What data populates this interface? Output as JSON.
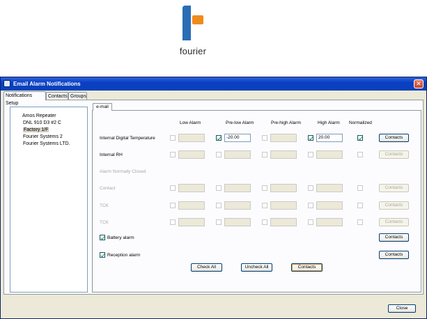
{
  "logo": {
    "text": "fourier"
  },
  "window": {
    "title": "Email Alarm Notifications",
    "close_glyph": "✕"
  },
  "tabs": [
    "Notifications Setup",
    "Contacts",
    "Groups"
  ],
  "tree": {
    "items": [
      {
        "label": "Amos Repeater",
        "root": true,
        "selected": false
      },
      {
        "label": "DNL 910 D3 #2 C",
        "root": false,
        "selected": false
      },
      {
        "label": "Factory 1/F",
        "root": false,
        "selected": true
      },
      {
        "label": "Fourier Systems 2",
        "root": false,
        "selected": false
      },
      {
        "label": "Fourier Systems LTD.",
        "root": false,
        "selected": false
      }
    ]
  },
  "inner_tab": "e-mail",
  "columns": {
    "low": "Low Alarm",
    "prelow": "Pre-low Alarm",
    "prehigh": "Pre-high Alarm",
    "high": "High Alarm",
    "normalized": "Normalized"
  },
  "rows": [
    {
      "label": "Internal Digital Temperature",
      "enabled": true,
      "low": {
        "checked": false,
        "value": ""
      },
      "prelow": {
        "checked": true,
        "value": "-20.00"
      },
      "prehigh": {
        "checked": false,
        "value": ""
      },
      "high": {
        "checked": true,
        "value": "20.00"
      },
      "normalized": true,
      "contacts_enabled": true
    },
    {
      "label": "Internal RH",
      "enabled": true,
      "low": {
        "checked": false,
        "value": ""
      },
      "prelow": {
        "checked": false,
        "value": ""
      },
      "prehigh": {
        "checked": false,
        "value": ""
      },
      "high": {
        "checked": false,
        "value": ""
      },
      "normalized": false,
      "contacts_enabled": false
    },
    {
      "label": "Alarm Normally Closed",
      "enabled": false,
      "header_only": true
    },
    {
      "label": "Contact",
      "enabled": false,
      "low": {
        "checked": false,
        "value": ""
      },
      "prelow": {
        "checked": false,
        "value": ""
      },
      "prehigh": {
        "checked": false,
        "value": ""
      },
      "high": {
        "checked": false,
        "value": ""
      },
      "normalized": false,
      "contacts_enabled": false
    },
    {
      "label": "TCK",
      "enabled": false,
      "low": {
        "checked": false,
        "value": ""
      },
      "prelow": {
        "checked": false,
        "value": ""
      },
      "prehigh": {
        "checked": false,
        "value": ""
      },
      "high": {
        "checked": false,
        "value": ""
      },
      "normalized": false,
      "contacts_enabled": false
    },
    {
      "label": "TCK",
      "enabled": false,
      "low": {
        "checked": false,
        "value": ""
      },
      "prelow": {
        "checked": false,
        "value": ""
      },
      "prehigh": {
        "checked": false,
        "value": ""
      },
      "high": {
        "checked": false,
        "value": ""
      },
      "normalized": false,
      "contacts_enabled": false
    }
  ],
  "battery": {
    "label": "Battery alarm",
    "checked": true
  },
  "reception": {
    "label": "Reception alarm",
    "checked": true
  },
  "buttons": {
    "contacts": "Contacts",
    "check_all": "Check All",
    "uncheck_all": "Uncheck All",
    "close": "Close"
  }
}
